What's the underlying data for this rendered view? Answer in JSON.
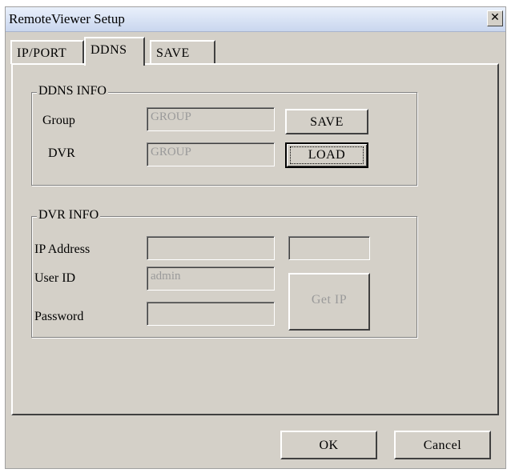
{
  "window": {
    "title": "RemoteViewer Setup",
    "close_glyph": "✕"
  },
  "tabs": [
    {
      "label": "IP/PORT",
      "active": false
    },
    {
      "label": "DDNS",
      "active": true
    },
    {
      "label": "SAVE",
      "active": false
    }
  ],
  "ddns_info": {
    "legend": "DDNS INFO",
    "group_label": "Group",
    "group_value": "GROUP",
    "dvr_label": "DVR",
    "dvr_value": "GROUP",
    "save_button": "SAVE",
    "load_button": "LOAD"
  },
  "dvr_info": {
    "legend": "DVR INFO",
    "ip_label": "IP Address",
    "ip_value": "",
    "port_value": "",
    "userid_label": "User ID",
    "userid_value": "admin",
    "password_label": "Password",
    "password_value": "",
    "getip_button": "Get IP"
  },
  "footer": {
    "ok_button": "OK",
    "cancel_button": "Cancel"
  }
}
